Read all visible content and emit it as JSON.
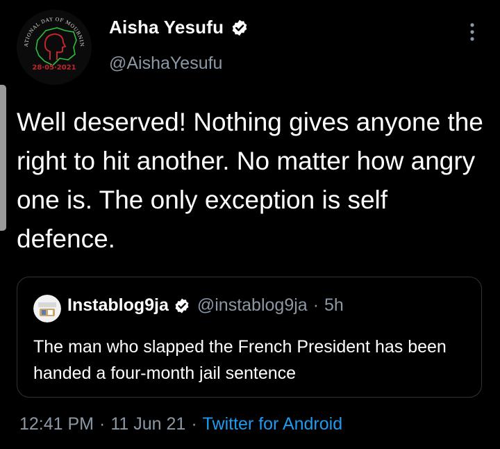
{
  "author": {
    "name": "Aisha Yesufu",
    "handle": "@AishaYesufu",
    "avatar_caption_top": "NATIONAL DAY OF MOURNING",
    "avatar_caption_date": "28·05·2021",
    "verified_icon": "verified-badge-icon"
  },
  "tweet": {
    "text": "Well deserved! Nothing gives anyone the right to hit another. No matter how angry one is. The only exception is self defence."
  },
  "quoted_tweet": {
    "name": "Instablog9ja",
    "handle": "@instablog9ja",
    "separator": "·",
    "time": "5h",
    "text": "The man who slapped the French President has been handed a four-month jail sentence"
  },
  "meta": {
    "time": "12:41 PM",
    "separator": "·",
    "date": "11 Jun 21",
    "source": "Twitter for Android"
  },
  "colors": {
    "background": "#000000",
    "text": "#ffffff",
    "secondary_text": "#8b98a5",
    "link": "#1d9bf0",
    "border": "#2f3336",
    "avatar_red": "#c0262c",
    "avatar_green": "#2fbf3f"
  }
}
